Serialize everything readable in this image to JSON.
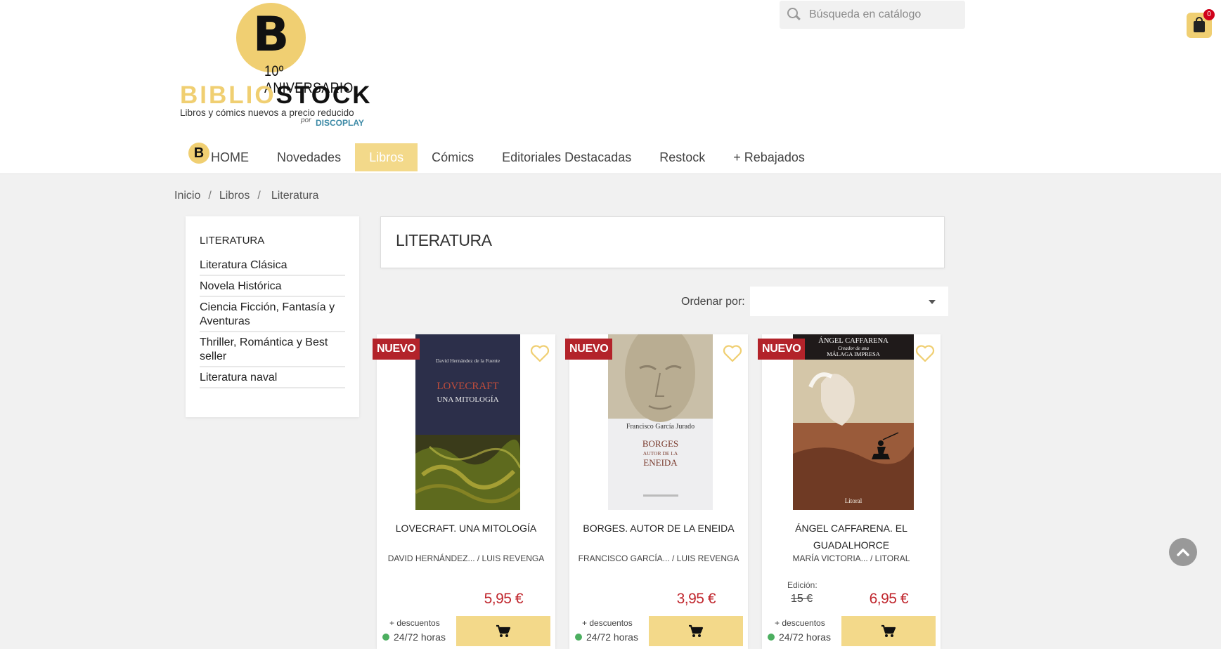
{
  "logo": {
    "letter": "B",
    "anniversary": "10º ANIVERSARIO",
    "name_part1": "BIBLIO",
    "name_part2": "STOCK",
    "tagline": "Libros y cómics nuevos a precio reducido",
    "by": "por",
    "partner": "DISCOPLAY",
    "colors": {
      "brand_yellow": "#f0cf72",
      "partner_blue": "#3d8aa6"
    }
  },
  "search": {
    "placeholder": "Búsqueda en catálogo",
    "icon": "search-icon"
  },
  "cart": {
    "count": "0",
    "icon": "shopping-bag-icon"
  },
  "nav": {
    "home_badge": "B",
    "items": [
      "HOME",
      "Novedades",
      "Libros",
      "Cómics",
      "Editoriales Destacadas",
      "Restock",
      "+ Rebajados"
    ],
    "active": "Libros"
  },
  "breadcrumb": [
    "Inicio",
    "Libros",
    "Literatura"
  ],
  "sidebar": {
    "title": "LITERATURA",
    "items": [
      "Literatura Clásica",
      "Novela Histórica",
      "Ciencia Ficción, Fantasía y Aventuras",
      "Thriller, Romántica y Best seller",
      "Literatura naval"
    ]
  },
  "category": {
    "title": "LITERATURA"
  },
  "sort": {
    "label": "Ordenar por:",
    "value": ""
  },
  "products": [
    {
      "badge": "NUEVO",
      "cover": {
        "author": "David Hernández de la Fuente",
        "title1": "LOVECRAFT",
        "title2": "UNA MITOLOGÍA"
      },
      "title": "LOVECRAFT. UNA MITOLOGÍA",
      "authors": "DAVID HERNÁNDEZ... / LUIS REVENGA",
      "price": "5,95 €",
      "discount_note": "+ descuentos",
      "availability": "24/72 horas"
    },
    {
      "badge": "NUEVO",
      "cover": {
        "author": "Francisco García Jurado",
        "title1": "BORGES",
        "title2": "AUTOR DE LA",
        "title3": "ENEIDA"
      },
      "title": "BORGES. AUTOR DE LA ENEIDA",
      "authors": "FRANCISCO GARCÍA... / LUIS REVENGA",
      "price": "3,95 €",
      "discount_note": "+ descuentos",
      "availability": "24/72 horas"
    },
    {
      "badge": "NUEVO",
      "cover": {
        "title1": "ÁNGEL CAFFARENA",
        "title2": "Creador de una",
        "title3": "MÁLAGA IMPRESA",
        "publisher": "Litoral"
      },
      "title": "ÁNGEL CAFFARENA. EL GUADALHORCE",
      "authors": "MARÍA VICTORIA... / LITORAL",
      "edition_label": "Edición:",
      "old_price": "15 €",
      "price": "6,95 €",
      "discount_note": "+ descuentos",
      "availability": "24/72 horas"
    }
  ],
  "colors": {
    "price_red": "#c0262d",
    "badge_red": "#b3232a",
    "available_green": "#4caf60",
    "nav_active_bg": "#f3d98a"
  }
}
